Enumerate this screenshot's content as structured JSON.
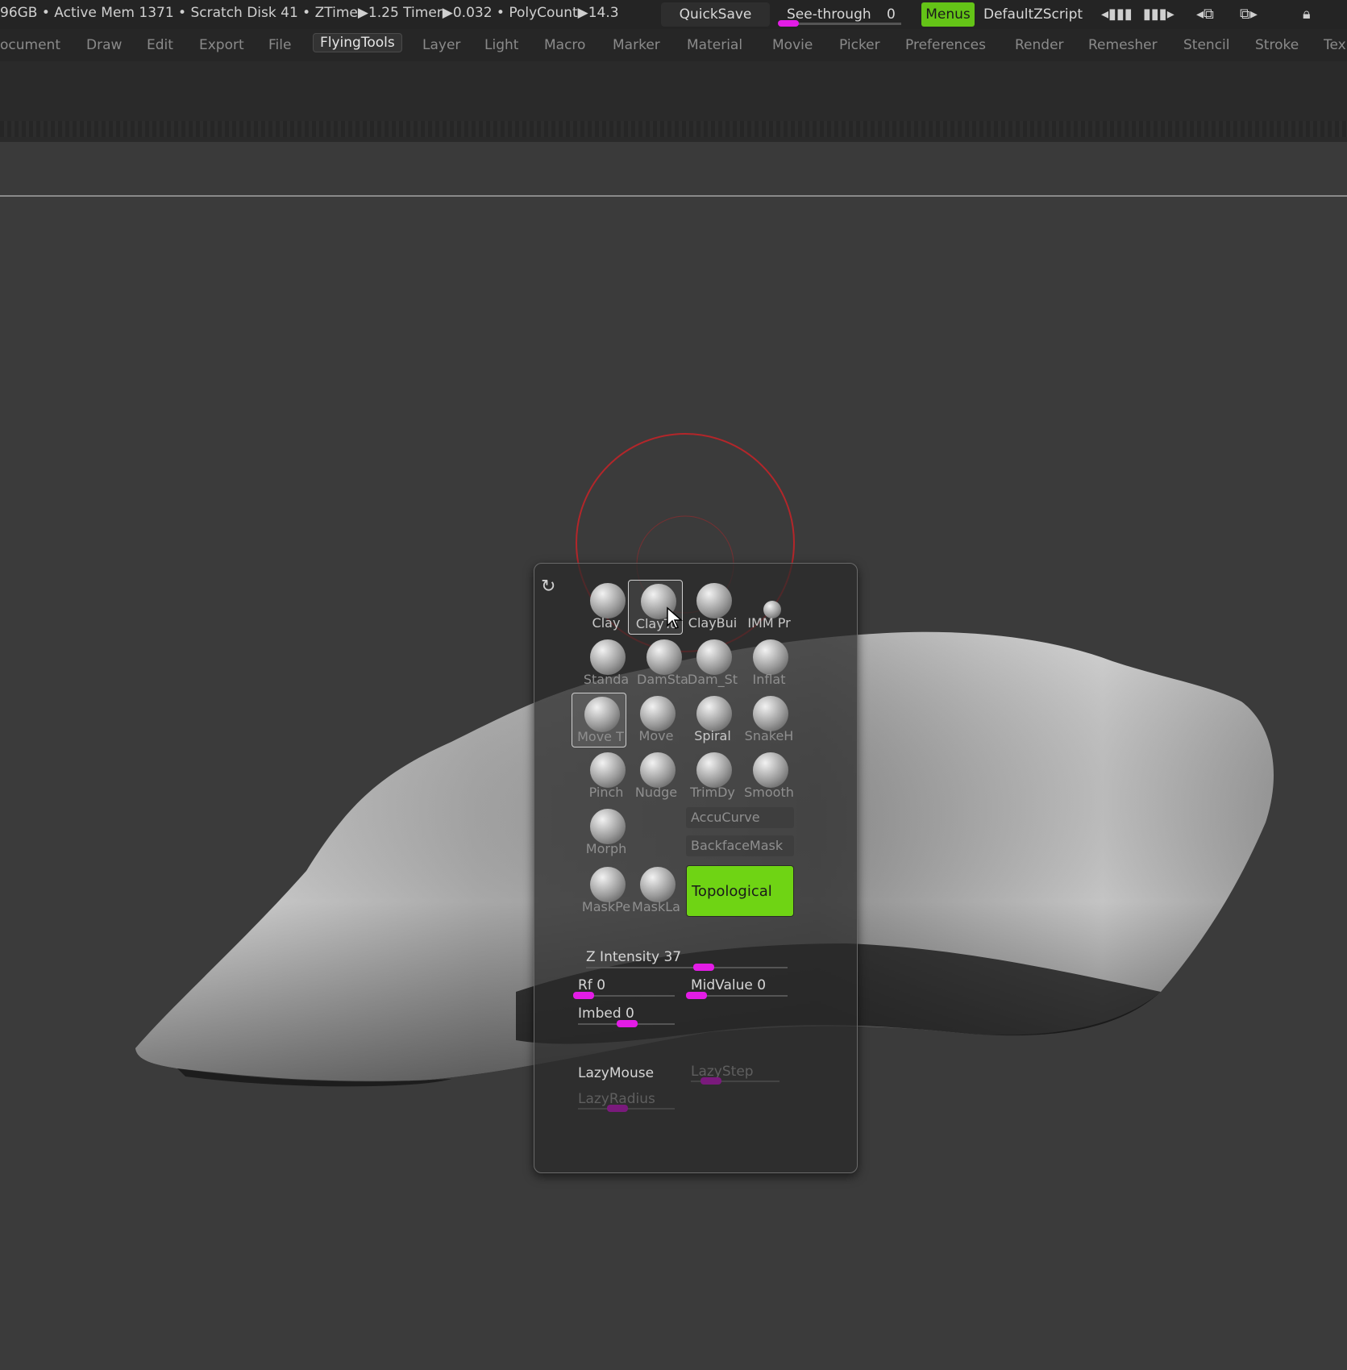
{
  "status_bar": {
    "text": "96GB • Active Mem 1371 • Scratch Disk 41 • ZTime▶1.25 Timer▶0.032 • PolyCount▶14.3",
    "quicksave": "QuickSave",
    "see_through_label": "See-through",
    "see_through_value": "0",
    "menus": "Menus",
    "default_zscript": "DefaultZScript",
    "accent_green": "#64c417",
    "slider_color": "#e31ce6"
  },
  "menu": {
    "items": [
      "ocument",
      "Draw",
      "Edit",
      "Export",
      "File",
      "FlyingTools",
      "Layer",
      "Light",
      "Macro",
      "Marker",
      "Material",
      "Movie",
      "Picker",
      "Preferences",
      "Render",
      "Remesher",
      "Stencil",
      "Stroke",
      "Tex"
    ],
    "active": "FlyingTools"
  },
  "popup": {
    "brushes": [
      {
        "label": "Clay",
        "icon": "clay-brush-icon"
      },
      {
        "label": "ClayTu",
        "icon": "claytubes-brush-icon",
        "selected": true
      },
      {
        "label": "ClayBui",
        "icon": "claybuildup-brush-icon"
      },
      {
        "label": "IMM Pr",
        "icon": "imm-primitives-brush-icon"
      },
      {
        "label": "Standa",
        "icon": "standard-brush-icon"
      },
      {
        "label": "DamSta",
        "icon": "damstandard-brush-icon"
      },
      {
        "label": "Dam_St",
        "icon": "damstandard2-brush-icon"
      },
      {
        "label": "Inflat",
        "icon": "inflate-brush-icon"
      },
      {
        "label": "Move T",
        "icon": "move-topological-brush-icon"
      },
      {
        "label": "Move",
        "icon": "move-brush-icon"
      },
      {
        "label": "Spiral",
        "icon": "spiral-brush-icon"
      },
      {
        "label": "SnakeH",
        "icon": "snakehook-brush-icon"
      },
      {
        "label": "Pinch",
        "icon": "pinch-brush-icon"
      },
      {
        "label": "Nudge",
        "icon": "nudge-brush-icon"
      },
      {
        "label": "TrimDy",
        "icon": "trimdynamic-brush-icon"
      },
      {
        "label": "Smooth",
        "icon": "smooth-brush-icon"
      },
      {
        "label": "Morph",
        "icon": "morph-brush-icon"
      },
      {
        "label": "MaskPe",
        "icon": "maskpen-brush-icon"
      },
      {
        "label": "MaskLa",
        "icon": "masklasso-brush-icon"
      }
    ],
    "accucurve": "AccuCurve",
    "backfacemask": "BackfaceMask",
    "topological": "Topological",
    "z_intensity_label": "Z Intensity",
    "z_intensity_value": "37",
    "rf_label": "Rf",
    "rf_value": "0",
    "midvalue_label": "MidValue",
    "midvalue_value": "0",
    "imbed_label": "Imbed",
    "imbed_value": "0",
    "lazymouse": "LazyMouse",
    "lazystep": "LazyStep",
    "lazyradius": "LazyRadius"
  }
}
